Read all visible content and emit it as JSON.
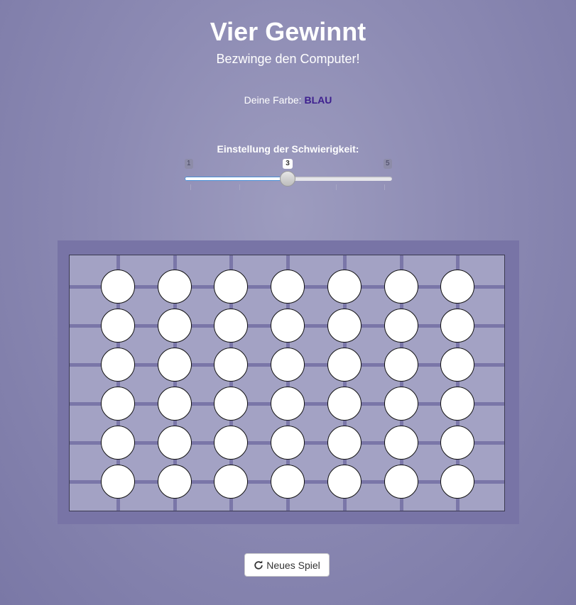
{
  "header": {
    "title": "Vier Gewinnt",
    "subtitle": "Bezwinge den Computer!"
  },
  "player": {
    "color_label": "Deine Farbe:",
    "color_value": "BLAU",
    "color_hex": "#3d1f8f"
  },
  "difficulty": {
    "label": "Einstellung der Schwierigkeit:",
    "min": "1",
    "max": "5",
    "value": "3"
  },
  "board": {
    "columns": 7,
    "rows": 6,
    "cells": [
      [
        "empty",
        "empty",
        "empty",
        "empty",
        "empty",
        "empty",
        "empty"
      ],
      [
        "empty",
        "empty",
        "empty",
        "empty",
        "empty",
        "empty",
        "empty"
      ],
      [
        "empty",
        "empty",
        "empty",
        "empty",
        "empty",
        "empty",
        "empty"
      ],
      [
        "empty",
        "empty",
        "empty",
        "empty",
        "empty",
        "empty",
        "empty"
      ],
      [
        "empty",
        "empty",
        "empty",
        "empty",
        "empty",
        "empty",
        "empty"
      ],
      [
        "empty",
        "empty",
        "empty",
        "empty",
        "empty",
        "empty",
        "empty"
      ]
    ],
    "frame_color": "#7874a6",
    "grid_color": "#a3a2c4"
  },
  "actions": {
    "new_game_label": "Neues Spiel",
    "new_game_icon": "refresh-icon"
  }
}
